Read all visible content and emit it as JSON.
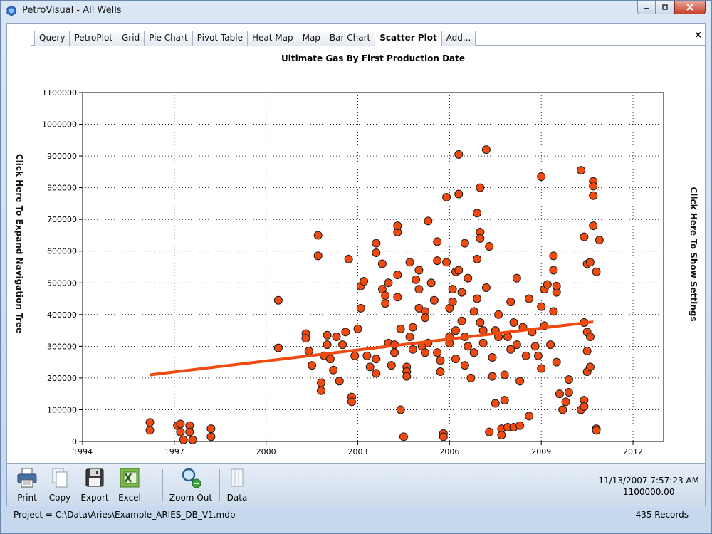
{
  "window": {
    "title": "PetroVisual - All Wells",
    "minimize_icon": "minimize-icon",
    "maximize_icon": "restore-icon",
    "close_icon": "close-icon"
  },
  "left_rail": {
    "label": "Click Here To Expand Navigation Tree"
  },
  "right_rail": {
    "label": "Click Here To Show Settings"
  },
  "tabs": [
    {
      "label": "Query"
    },
    {
      "label": "PetroPlot"
    },
    {
      "label": "Grid"
    },
    {
      "label": "Pie Chart"
    },
    {
      "label": "Pivot Table"
    },
    {
      "label": "Heat Map"
    },
    {
      "label": "Map"
    },
    {
      "label": "Bar Chart"
    },
    {
      "label": "Scatter Plot"
    },
    {
      "label": "Add..."
    }
  ],
  "active_tab": "Scatter Plot",
  "tab_close_label": "×",
  "toolbar": {
    "items": [
      {
        "label": "Print",
        "icon": "printer-icon"
      },
      {
        "label": "Copy",
        "icon": "copy-icon"
      },
      {
        "label": "Export",
        "icon": "floppy-disk-icon"
      },
      {
        "label": "Excel",
        "icon": "excel-icon"
      },
      {
        "label": "Zoom Out",
        "icon": "magnifier-zoom-out-icon"
      },
      {
        "label": "Data",
        "icon": "data-icon"
      }
    ],
    "readout_date": "11/13/2007 7:57:23 AM",
    "readout_value": "1100000.00"
  },
  "status": {
    "project": "Project = C:\\Data\\Aries\\Example_ARIES_DB_V1.mdb",
    "records": "435 Records"
  },
  "colors": {
    "marker_fill": "#f04a10",
    "marker_stroke": "#1a1a1a",
    "trend_line": "#f04a10"
  },
  "chart_data": {
    "type": "scatter",
    "title": "Ultimate Gas By First Production Date",
    "xlabel": "",
    "ylabel": "",
    "xlim": [
      1994,
      2013
    ],
    "ylim": [
      0,
      1100000
    ],
    "x_ticks": [
      "1994",
      "1997",
      "2000",
      "2003",
      "2006",
      "2009",
      "2012"
    ],
    "y_ticks": [
      "0",
      "100000",
      "200000",
      "300000",
      "400000",
      "500000",
      "600000",
      "700000",
      "800000",
      "900000",
      "1000000",
      "1100000"
    ],
    "grid": true,
    "trend_line": {
      "x": [
        1996.2,
        2010.7
      ],
      "y": [
        210000,
        377000
      ]
    },
    "points": [
      [
        1996.2,
        60000
      ],
      [
        1996.2,
        35000
      ],
      [
        1997.1,
        50000
      ],
      [
        1997.2,
        30000
      ],
      [
        1997.2,
        55000
      ],
      [
        1997.5,
        50000
      ],
      [
        1997.5,
        30000
      ],
      [
        1997.3,
        5000
      ],
      [
        1997.6,
        5000
      ],
      [
        1998.2,
        40000
      ],
      [
        1998.2,
        15000
      ],
      [
        2000.4,
        445000
      ],
      [
        2000.4,
        295000
      ],
      [
        2001.3,
        340000
      ],
      [
        2001.3,
        325000
      ],
      [
        2001.4,
        285000
      ],
      [
        2001.5,
        240000
      ],
      [
        2001.7,
        650000
      ],
      [
        2001.7,
        585000
      ],
      [
        2001.8,
        185000
      ],
      [
        2001.8,
        160000
      ],
      [
        2001.9,
        270000
      ],
      [
        2002.0,
        335000
      ],
      [
        2002.0,
        305000
      ],
      [
        2002.1,
        260000
      ],
      [
        2002.2,
        225000
      ],
      [
        2002.3,
        330000
      ],
      [
        2002.4,
        190000
      ],
      [
        2002.5,
        305000
      ],
      [
        2002.6,
        345000
      ],
      [
        2002.7,
        575000
      ],
      [
        2002.8,
        140000
      ],
      [
        2002.8,
        125000
      ],
      [
        2002.9,
        270000
      ],
      [
        2003.0,
        355000
      ],
      [
        2003.1,
        420000
      ],
      [
        2003.1,
        490000
      ],
      [
        2003.2,
        505000
      ],
      [
        2003.3,
        270000
      ],
      [
        2003.4,
        235000
      ],
      [
        2003.6,
        625000
      ],
      [
        2003.6,
        595000
      ],
      [
        2003.6,
        260000
      ],
      [
        2003.6,
        215000
      ],
      [
        2003.8,
        560000
      ],
      [
        2003.8,
        480000
      ],
      [
        2003.9,
        435000
      ],
      [
        2003.9,
        460000
      ],
      [
        2004.0,
        500000
      ],
      [
        2004.0,
        310000
      ],
      [
        2004.1,
        240000
      ],
      [
        2004.2,
        305000
      ],
      [
        2004.2,
        280000
      ],
      [
        2004.3,
        660000
      ],
      [
        2004.3,
        680000
      ],
      [
        2004.3,
        525000
      ],
      [
        2004.3,
        455000
      ],
      [
        2004.4,
        355000
      ],
      [
        2004.4,
        100000
      ],
      [
        2004.5,
        15000
      ],
      [
        2004.6,
        235000
      ],
      [
        2004.6,
        220000
      ],
      [
        2004.6,
        205000
      ],
      [
        2004.7,
        330000
      ],
      [
        2004.7,
        565000
      ],
      [
        2004.8,
        360000
      ],
      [
        2004.8,
        290000
      ],
      [
        2004.9,
        510000
      ],
      [
        2005.0,
        480000
      ],
      [
        2005.0,
        420000
      ],
      [
        2005.0,
        540000
      ],
      [
        2005.1,
        300000
      ],
      [
        2005.2,
        410000
      ],
      [
        2005.2,
        390000
      ],
      [
        2005.2,
        280000
      ],
      [
        2005.3,
        695000
      ],
      [
        2005.3,
        310000
      ],
      [
        2005.4,
        500000
      ],
      [
        2005.5,
        445000
      ],
      [
        2005.6,
        630000
      ],
      [
        2005.6,
        570000
      ],
      [
        2005.6,
        280000
      ],
      [
        2005.7,
        255000
      ],
      [
        2005.7,
        220000
      ],
      [
        2005.8,
        25000
      ],
      [
        2005.8,
        15000
      ],
      [
        2005.9,
        770000
      ],
      [
        2005.9,
        565000
      ],
      [
        2006.0,
        420000
      ],
      [
        2006.0,
        330000
      ],
      [
        2006.0,
        310000
      ],
      [
        2006.1,
        480000
      ],
      [
        2006.1,
        440000
      ],
      [
        2006.2,
        535000
      ],
      [
        2006.2,
        350000
      ],
      [
        2006.2,
        260000
      ],
      [
        2006.3,
        905000
      ],
      [
        2006.3,
        780000
      ],
      [
        2006.3,
        540000
      ],
      [
        2006.4,
        470000
      ],
      [
        2006.4,
        380000
      ],
      [
        2006.5,
        625000
      ],
      [
        2006.5,
        330000
      ],
      [
        2006.5,
        240000
      ],
      [
        2006.6,
        515000
      ],
      [
        2006.6,
        300000
      ],
      [
        2006.7,
        200000
      ],
      [
        2006.8,
        410000
      ],
      [
        2006.8,
        280000
      ],
      [
        2006.9,
        720000
      ],
      [
        2006.9,
        575000
      ],
      [
        2006.9,
        450000
      ],
      [
        2007.0,
        800000
      ],
      [
        2007.0,
        660000
      ],
      [
        2007.0,
        640000
      ],
      [
        2007.0,
        375000
      ],
      [
        2007.1,
        350000
      ],
      [
        2007.1,
        310000
      ],
      [
        2007.2,
        920000
      ],
      [
        2007.2,
        485000
      ],
      [
        2007.3,
        615000
      ],
      [
        2007.3,
        30000
      ],
      [
        2007.4,
        265000
      ],
      [
        2007.4,
        205000
      ],
      [
        2007.5,
        120000
      ],
      [
        2007.5,
        350000
      ],
      [
        2007.6,
        400000
      ],
      [
        2007.6,
        330000
      ],
      [
        2007.7,
        40000
      ],
      [
        2007.7,
        20000
      ],
      [
        2007.8,
        210000
      ],
      [
        2007.8,
        130000
      ],
      [
        2007.9,
        330000
      ],
      [
        2007.9,
        45000
      ],
      [
        2008.0,
        440000
      ],
      [
        2008.0,
        290000
      ],
      [
        2008.1,
        375000
      ],
      [
        2008.1,
        45000
      ],
      [
        2008.2,
        515000
      ],
      [
        2008.2,
        305000
      ],
      [
        2008.3,
        190000
      ],
      [
        2008.3,
        50000
      ],
      [
        2008.4,
        360000
      ],
      [
        2008.5,
        270000
      ],
      [
        2008.6,
        450000
      ],
      [
        2008.6,
        80000
      ],
      [
        2008.7,
        345000
      ],
      [
        2008.8,
        300000
      ],
      [
        2008.9,
        270000
      ],
      [
        2009.0,
        835000
      ],
      [
        2009.0,
        425000
      ],
      [
        2009.0,
        230000
      ],
      [
        2009.1,
        480000
      ],
      [
        2009.1,
        365000
      ],
      [
        2009.2,
        495000
      ],
      [
        2009.3,
        305000
      ],
      [
        2009.4,
        410000
      ],
      [
        2009.4,
        585000
      ],
      [
        2009.4,
        540000
      ],
      [
        2009.5,
        470000
      ],
      [
        2009.5,
        490000
      ],
      [
        2009.5,
        250000
      ],
      [
        2009.6,
        150000
      ],
      [
        2009.7,
        100000
      ],
      [
        2009.8,
        125000
      ],
      [
        2009.9,
        155000
      ],
      [
        2009.9,
        195000
      ],
      [
        2010.3,
        855000
      ],
      [
        2010.3,
        100000
      ],
      [
        2010.4,
        645000
      ],
      [
        2010.4,
        375000
      ],
      [
        2010.4,
        130000
      ],
      [
        2010.4,
        110000
      ],
      [
        2010.5,
        560000
      ],
      [
        2010.5,
        345000
      ],
      [
        2010.5,
        285000
      ],
      [
        2010.5,
        220000
      ],
      [
        2010.6,
        565000
      ],
      [
        2010.6,
        330000
      ],
      [
        2010.6,
        235000
      ],
      [
        2010.7,
        775000
      ],
      [
        2010.7,
        820000
      ],
      [
        2010.7,
        805000
      ],
      [
        2010.7,
        680000
      ],
      [
        2010.8,
        535000
      ],
      [
        2010.8,
        40000
      ],
      [
        2010.8,
        35000
      ],
      [
        2010.9,
        635000
      ]
    ]
  }
}
